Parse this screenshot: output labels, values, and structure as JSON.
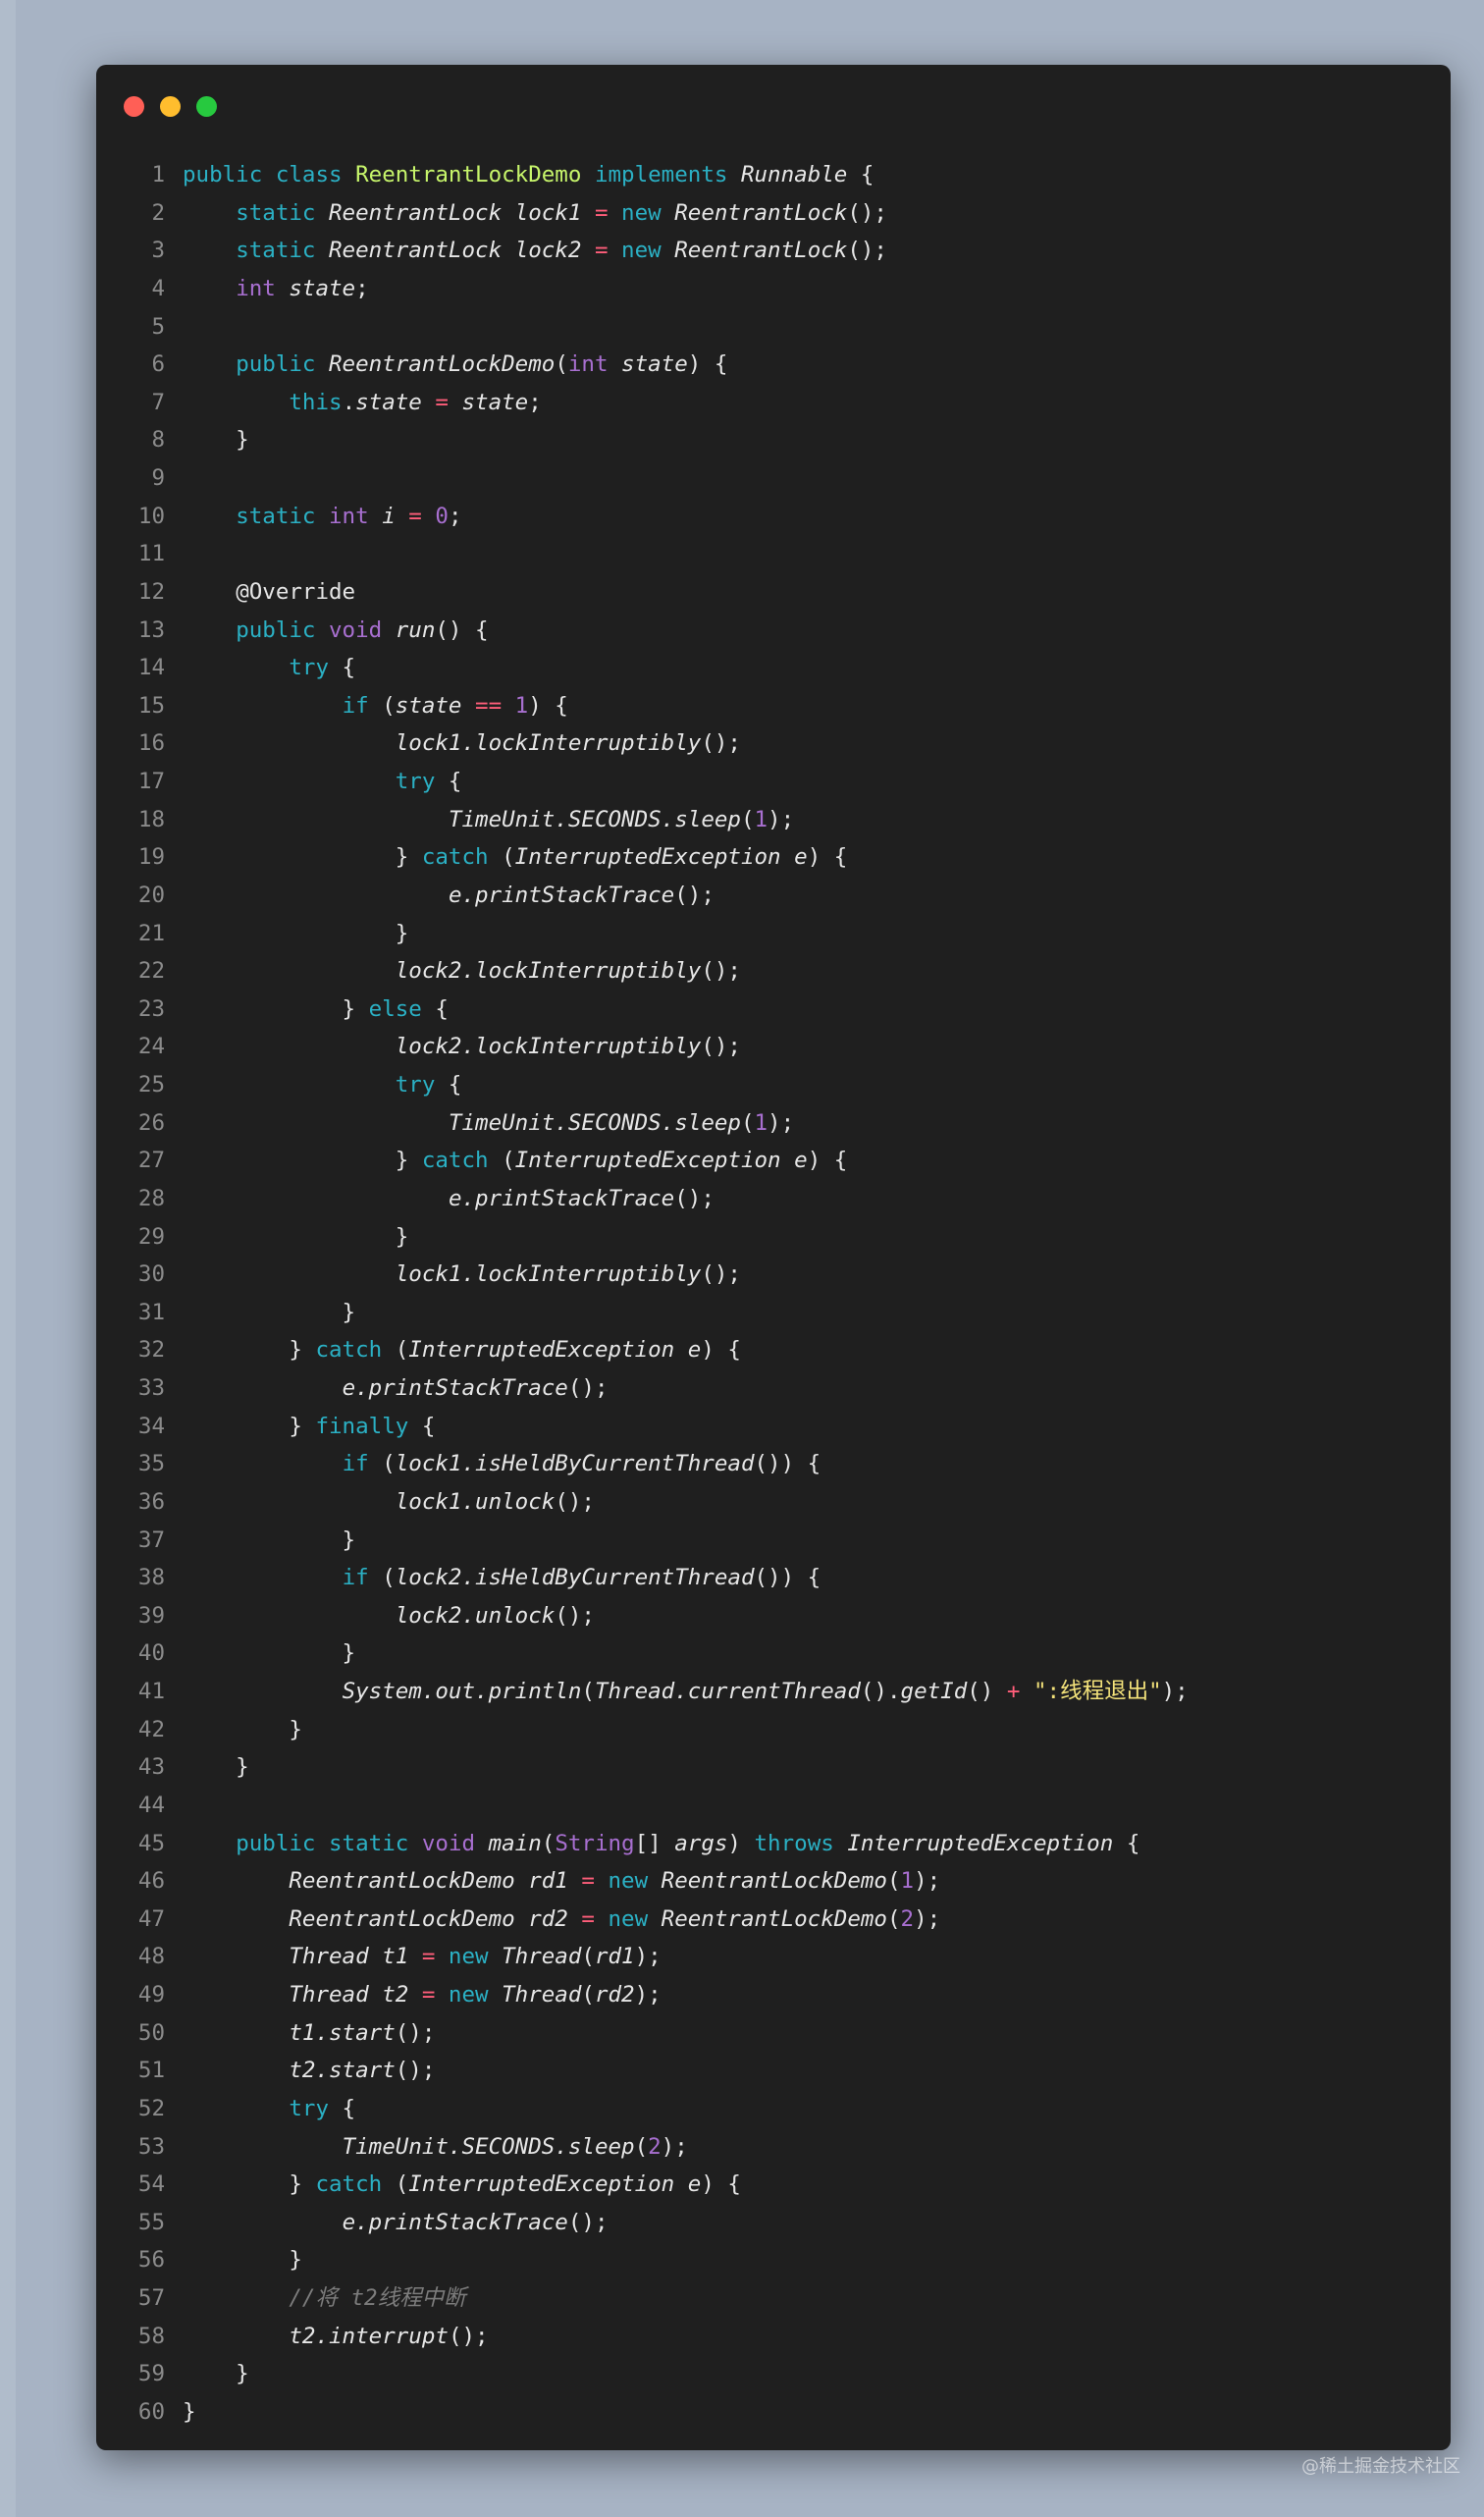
{
  "window": {
    "controls": [
      {
        "name": "close",
        "color": "#ff5f56"
      },
      {
        "name": "minimize",
        "color": "#ffbd2e"
      },
      {
        "name": "zoom",
        "color": "#27c93f"
      }
    ]
  },
  "watermark": "@稀土掘金技术社区",
  "lines": [
    [
      [
        "kw",
        "public "
      ],
      [
        "kw",
        "class "
      ],
      [
        "cls",
        "ReentrantLockDemo"
      ],
      [
        "kw",
        " implements "
      ],
      [
        "it",
        "Runnable"
      ],
      [
        "txt",
        " {"
      ]
    ],
    [
      [
        "txt",
        "    "
      ],
      [
        "kw",
        "static "
      ],
      [
        "it",
        "ReentrantLock lock1 "
      ],
      [
        "op",
        "="
      ],
      [
        "kw",
        " new "
      ],
      [
        "it",
        "ReentrantLock"
      ],
      [
        "txt",
        "();"
      ]
    ],
    [
      [
        "txt",
        "    "
      ],
      [
        "kw",
        "static "
      ],
      [
        "it",
        "ReentrantLock lock2 "
      ],
      [
        "op",
        "="
      ],
      [
        "kw",
        " new "
      ],
      [
        "it",
        "ReentrantLock"
      ],
      [
        "txt",
        "();"
      ]
    ],
    [
      [
        "txt",
        "    "
      ],
      [
        "pm",
        "int "
      ],
      [
        "it",
        "state"
      ],
      [
        "txt",
        ";"
      ]
    ],
    [],
    [
      [
        "txt",
        "    "
      ],
      [
        "kw",
        "public "
      ],
      [
        "it",
        "ReentrantLockDemo"
      ],
      [
        "txt",
        "("
      ],
      [
        "pm",
        "int "
      ],
      [
        "it",
        "state"
      ],
      [
        "txt",
        ") {"
      ]
    ],
    [
      [
        "txt",
        "        "
      ],
      [
        "kw",
        "this"
      ],
      [
        "txt",
        "."
      ],
      [
        "it",
        "state "
      ],
      [
        "op",
        "="
      ],
      [
        "it",
        " state"
      ],
      [
        "txt",
        ";"
      ]
    ],
    [
      [
        "txt",
        "    }"
      ]
    ],
    [],
    [
      [
        "txt",
        "    "
      ],
      [
        "kw",
        "static "
      ],
      [
        "pm",
        "int "
      ],
      [
        "it",
        "i "
      ],
      [
        "op",
        "="
      ],
      [
        "num",
        " 0"
      ],
      [
        "txt",
        ";"
      ]
    ],
    [],
    [
      [
        "txt",
        "    "
      ],
      [
        "ann",
        "@Override"
      ]
    ],
    [
      [
        "txt",
        "    "
      ],
      [
        "kw",
        "public "
      ],
      [
        "pm",
        "void "
      ],
      [
        "it",
        "run"
      ],
      [
        "txt",
        "() {"
      ]
    ],
    [
      [
        "txt",
        "        "
      ],
      [
        "kw",
        "try"
      ],
      [
        "txt",
        " {"
      ]
    ],
    [
      [
        "txt",
        "            "
      ],
      [
        "kw",
        "if"
      ],
      [
        "txt",
        " ("
      ],
      [
        "it",
        "state "
      ],
      [
        "op",
        "=="
      ],
      [
        "num",
        " 1"
      ],
      [
        "txt",
        ") {"
      ]
    ],
    [
      [
        "txt",
        "                "
      ],
      [
        "it",
        "lock1.lockInterruptibly"
      ],
      [
        "txt",
        "();"
      ]
    ],
    [
      [
        "txt",
        "                "
      ],
      [
        "kw",
        "try"
      ],
      [
        "txt",
        " {"
      ]
    ],
    [
      [
        "txt",
        "                    "
      ],
      [
        "it",
        "TimeUnit.SECONDS.sleep"
      ],
      [
        "txt",
        "("
      ],
      [
        "num",
        "1"
      ],
      [
        "txt",
        ");"
      ]
    ],
    [
      [
        "txt",
        "                } "
      ],
      [
        "kw",
        "catch"
      ],
      [
        "txt",
        " ("
      ],
      [
        "it",
        "InterruptedException e"
      ],
      [
        "txt",
        ") {"
      ]
    ],
    [
      [
        "txt",
        "                    "
      ],
      [
        "it",
        "e.printStackTrace"
      ],
      [
        "txt",
        "();"
      ]
    ],
    [
      [
        "txt",
        "                }"
      ]
    ],
    [
      [
        "txt",
        "                "
      ],
      [
        "it",
        "lock2.lockInterruptibly"
      ],
      [
        "txt",
        "();"
      ]
    ],
    [
      [
        "txt",
        "            } "
      ],
      [
        "kw",
        "else"
      ],
      [
        "txt",
        " {"
      ]
    ],
    [
      [
        "txt",
        "                "
      ],
      [
        "it",
        "lock2.lockInterruptibly"
      ],
      [
        "txt",
        "();"
      ]
    ],
    [
      [
        "txt",
        "                "
      ],
      [
        "kw",
        "try"
      ],
      [
        "txt",
        " {"
      ]
    ],
    [
      [
        "txt",
        "                    "
      ],
      [
        "it",
        "TimeUnit.SECONDS.sleep"
      ],
      [
        "txt",
        "("
      ],
      [
        "num",
        "1"
      ],
      [
        "txt",
        ");"
      ]
    ],
    [
      [
        "txt",
        "                } "
      ],
      [
        "kw",
        "catch"
      ],
      [
        "txt",
        " ("
      ],
      [
        "it",
        "InterruptedException e"
      ],
      [
        "txt",
        ") {"
      ]
    ],
    [
      [
        "txt",
        "                    "
      ],
      [
        "it",
        "e.printStackTrace"
      ],
      [
        "txt",
        "();"
      ]
    ],
    [
      [
        "txt",
        "                }"
      ]
    ],
    [
      [
        "txt",
        "                "
      ],
      [
        "it",
        "lock1.lockInterruptibly"
      ],
      [
        "txt",
        "();"
      ]
    ],
    [
      [
        "txt",
        "            }"
      ]
    ],
    [
      [
        "txt",
        "        } "
      ],
      [
        "kw",
        "catch"
      ],
      [
        "txt",
        " ("
      ],
      [
        "it",
        "InterruptedException e"
      ],
      [
        "txt",
        ") {"
      ]
    ],
    [
      [
        "txt",
        "            "
      ],
      [
        "it",
        "e.printStackTrace"
      ],
      [
        "txt",
        "();"
      ]
    ],
    [
      [
        "txt",
        "        } "
      ],
      [
        "kw",
        "finally"
      ],
      [
        "txt",
        " {"
      ]
    ],
    [
      [
        "txt",
        "            "
      ],
      [
        "kw",
        "if"
      ],
      [
        "txt",
        " ("
      ],
      [
        "it",
        "lock1.isHeldByCurrentThread"
      ],
      [
        "txt",
        "()) {"
      ]
    ],
    [
      [
        "txt",
        "                "
      ],
      [
        "it",
        "lock1.unlock"
      ],
      [
        "txt",
        "();"
      ]
    ],
    [
      [
        "txt",
        "            }"
      ]
    ],
    [
      [
        "txt",
        "            "
      ],
      [
        "kw",
        "if"
      ],
      [
        "txt",
        " ("
      ],
      [
        "it",
        "lock2.isHeldByCurrentThread"
      ],
      [
        "txt",
        "()) {"
      ]
    ],
    [
      [
        "txt",
        "                "
      ],
      [
        "it",
        "lock2.unlock"
      ],
      [
        "txt",
        "();"
      ]
    ],
    [
      [
        "txt",
        "            }"
      ]
    ],
    [
      [
        "txt",
        "            "
      ],
      [
        "it",
        "System.out.println"
      ],
      [
        "txt",
        "("
      ],
      [
        "it",
        "Thread.currentThread"
      ],
      [
        "txt",
        "()."
      ],
      [
        "it",
        "getId"
      ],
      [
        "txt",
        "() "
      ],
      [
        "op",
        "+"
      ],
      [
        "str",
        " \":线程退出\""
      ],
      [
        "txt",
        ");"
      ]
    ],
    [
      [
        "txt",
        "        }"
      ]
    ],
    [
      [
        "txt",
        "    }"
      ]
    ],
    [],
    [
      [
        "txt",
        "    "
      ],
      [
        "kw",
        "public "
      ],
      [
        "kw",
        "static "
      ],
      [
        "pm",
        "void "
      ],
      [
        "it",
        "main"
      ],
      [
        "txt",
        "("
      ],
      [
        "pm",
        "String"
      ],
      [
        "txt",
        "[] "
      ],
      [
        "it",
        "args"
      ],
      [
        "txt",
        ") "
      ],
      [
        "kw",
        "throws "
      ],
      [
        "it",
        "InterruptedException"
      ],
      [
        "txt",
        " {"
      ]
    ],
    [
      [
        "txt",
        "        "
      ],
      [
        "it",
        "ReentrantLockDemo rd1 "
      ],
      [
        "op",
        "="
      ],
      [
        "kw",
        " new "
      ],
      [
        "it",
        "ReentrantLockDemo"
      ],
      [
        "txt",
        "("
      ],
      [
        "num",
        "1"
      ],
      [
        "txt",
        ");"
      ]
    ],
    [
      [
        "txt",
        "        "
      ],
      [
        "it",
        "ReentrantLockDemo rd2 "
      ],
      [
        "op",
        "="
      ],
      [
        "kw",
        " new "
      ],
      [
        "it",
        "ReentrantLockDemo"
      ],
      [
        "txt",
        "("
      ],
      [
        "num",
        "2"
      ],
      [
        "txt",
        ");"
      ]
    ],
    [
      [
        "txt",
        "        "
      ],
      [
        "it",
        "Thread t1 "
      ],
      [
        "op",
        "="
      ],
      [
        "kw",
        " new "
      ],
      [
        "it",
        "Thread"
      ],
      [
        "txt",
        "("
      ],
      [
        "it",
        "rd1"
      ],
      [
        "txt",
        ");"
      ]
    ],
    [
      [
        "txt",
        "        "
      ],
      [
        "it",
        "Thread t2 "
      ],
      [
        "op",
        "="
      ],
      [
        "kw",
        " new "
      ],
      [
        "it",
        "Thread"
      ],
      [
        "txt",
        "("
      ],
      [
        "it",
        "rd2"
      ],
      [
        "txt",
        ");"
      ]
    ],
    [
      [
        "txt",
        "        "
      ],
      [
        "it",
        "t1.start"
      ],
      [
        "txt",
        "();"
      ]
    ],
    [
      [
        "txt",
        "        "
      ],
      [
        "it",
        "t2.start"
      ],
      [
        "txt",
        "();"
      ]
    ],
    [
      [
        "txt",
        "        "
      ],
      [
        "kw",
        "try"
      ],
      [
        "txt",
        " {"
      ]
    ],
    [
      [
        "txt",
        "            "
      ],
      [
        "it",
        "TimeUnit.SECONDS.sleep"
      ],
      [
        "txt",
        "("
      ],
      [
        "num",
        "2"
      ],
      [
        "txt",
        ");"
      ]
    ],
    [
      [
        "txt",
        "        } "
      ],
      [
        "kw",
        "catch"
      ],
      [
        "txt",
        " ("
      ],
      [
        "it",
        "InterruptedException e"
      ],
      [
        "txt",
        ") {"
      ]
    ],
    [
      [
        "txt",
        "            "
      ],
      [
        "it",
        "e.printStackTrace"
      ],
      [
        "txt",
        "();"
      ]
    ],
    [
      [
        "txt",
        "        }"
      ]
    ],
    [
      [
        "txt",
        "        "
      ],
      [
        "cm",
        "//将 t2线程中断"
      ]
    ],
    [
      [
        "txt",
        "        "
      ],
      [
        "it",
        "t2.interrupt"
      ],
      [
        "txt",
        "();"
      ]
    ],
    [
      [
        "txt",
        "    }"
      ]
    ],
    [
      [
        "txt",
        "}"
      ]
    ]
  ]
}
